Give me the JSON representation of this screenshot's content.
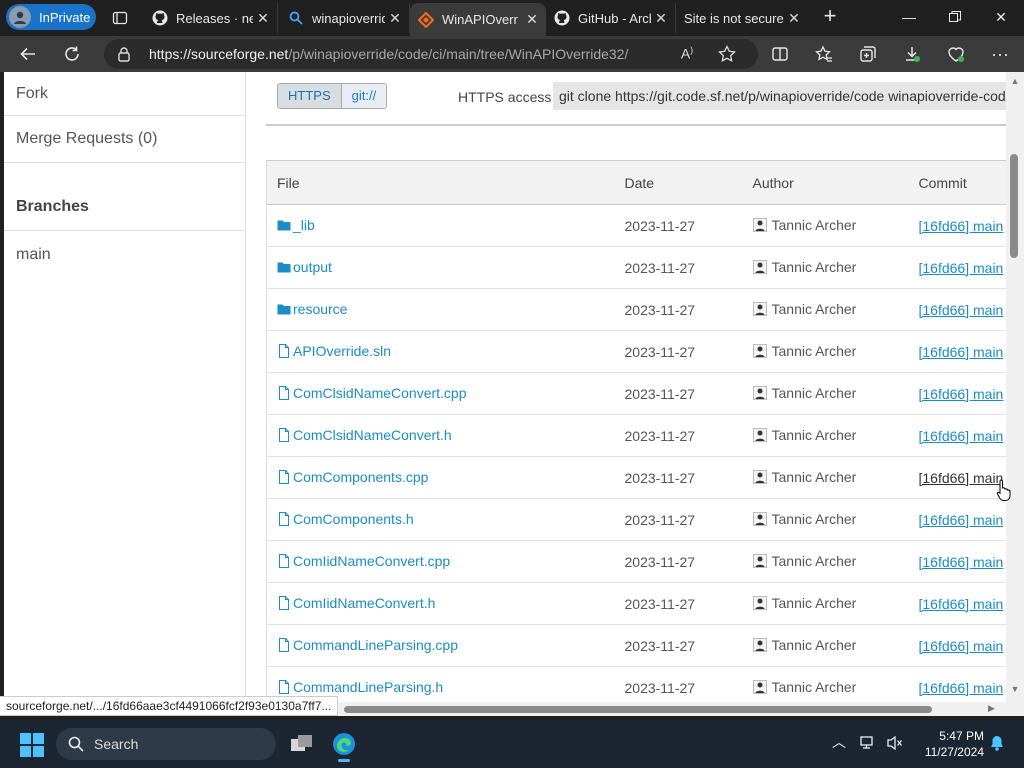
{
  "browser": {
    "inprivate_label": "InPrivate",
    "tabs": [
      {
        "title": "Releases · nel",
        "icon": "github-icon"
      },
      {
        "title": "winapioverrid",
        "icon": "search-icon"
      },
      {
        "title": "WinAPIOverr",
        "icon": "sourceforge-icon",
        "active": true
      },
      {
        "title": "GitHub - Arch",
        "icon": "github-icon"
      },
      {
        "title": "Site is not secure",
        "icon": "none"
      }
    ],
    "url_host": "https://sourceforge.net",
    "url_path": "/p/winapioverride/code/ci/main/tree/WinAPIOverride32/"
  },
  "sidebar": {
    "fork_label": "Fork",
    "merge_requests_label": "Merge Requests",
    "merge_requests_count": "(0)",
    "branches_header": "Branches",
    "branch_main": "main"
  },
  "clone": {
    "https_label": "HTTPS",
    "git_label": "git://",
    "access_label": "HTTPS access",
    "command": "git clone https://git.code.sf.net/p/winapioverride/code winapioverride-code"
  },
  "table": {
    "headers": {
      "file": "File",
      "date": "Date",
      "author": "Author",
      "commit": "Commit"
    },
    "rows": [
      {
        "name": "_lib",
        "type": "folder",
        "date": "2023-11-27",
        "author": "Tannic Archer",
        "commit": "[16fd66] main"
      },
      {
        "name": "output",
        "type": "folder",
        "date": "2023-11-27",
        "author": "Tannic Archer",
        "commit": "[16fd66] main"
      },
      {
        "name": "resource",
        "type": "folder",
        "date": "2023-11-27",
        "author": "Tannic Archer",
        "commit": "[16fd66] main"
      },
      {
        "name": "APIOverride.sln",
        "type": "file",
        "date": "2023-11-27",
        "author": "Tannic Archer",
        "commit": "[16fd66] main"
      },
      {
        "name": "ComClsidNameConvert.cpp",
        "type": "file",
        "date": "2023-11-27",
        "author": "Tannic Archer",
        "commit": "[16fd66] main"
      },
      {
        "name": "ComClsidNameConvert.h",
        "type": "file",
        "date": "2023-11-27",
        "author": "Tannic Archer",
        "commit": "[16fd66] main"
      },
      {
        "name": "ComComponents.cpp",
        "type": "file",
        "date": "2023-11-27",
        "author": "Tannic Archer",
        "commit": "[16fd66] main",
        "hover": true
      },
      {
        "name": "ComComponents.h",
        "type": "file",
        "date": "2023-11-27",
        "author": "Tannic Archer",
        "commit": "[16fd66] main"
      },
      {
        "name": "ComIidNameConvert.cpp",
        "type": "file",
        "date": "2023-11-27",
        "author": "Tannic Archer",
        "commit": "[16fd66] main"
      },
      {
        "name": "ComIidNameConvert.h",
        "type": "file",
        "date": "2023-11-27",
        "author": "Tannic Archer",
        "commit": "[16fd66] main"
      },
      {
        "name": "CommandLineParsing.cpp",
        "type": "file",
        "date": "2023-11-27",
        "author": "Tannic Archer",
        "commit": "[16fd66] main"
      },
      {
        "name": "CommandLineParsing.h",
        "type": "file",
        "date": "2023-11-27",
        "author": "Tannic Archer",
        "commit": "[16fd66] main"
      }
    ]
  },
  "status_url": "sourceforge.net/.../16fd66aae3cf4491066fcf2f93e0130a7ff7...",
  "taskbar": {
    "search_label": "Search",
    "time": "5:47 PM",
    "date": "11/27/2024"
  },
  "colors": {
    "link": "#1a8cc7",
    "accent": "#1a73c9"
  }
}
